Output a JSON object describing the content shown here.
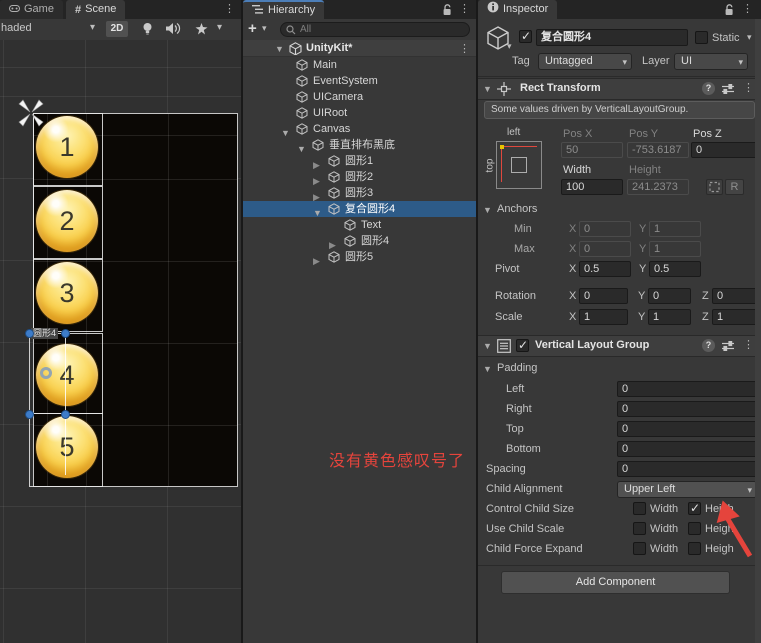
{
  "icons": {
    "ellipsis": "⋮",
    "caret": "▾",
    "tri_open": "▼",
    "tri_closed": "▶",
    "scene_tab": "#",
    "plus": "+",
    "help": "?"
  },
  "scene": {
    "tabs": [
      {
        "label": "Game"
      },
      {
        "label": "Scene"
      }
    ],
    "toolbar": {
      "shading": "haded",
      "mode2d": "2D"
    },
    "circles": [
      {
        "label": "1"
      },
      {
        "label": "2"
      },
      {
        "label": "3"
      },
      {
        "label": "4"
      },
      {
        "label": "5"
      }
    ],
    "selection_tag": "圆形4"
  },
  "hierarchy": {
    "tab": "Hierarchy",
    "search_placeholder": "All",
    "root_name": "UnityKit*",
    "items": [
      {
        "label": "Main",
        "depth": 1,
        "arrow": "none"
      },
      {
        "label": "EventSystem",
        "depth": 1,
        "arrow": "none"
      },
      {
        "label": "UICamera",
        "depth": 1,
        "arrow": "none"
      },
      {
        "label": "UIRoot",
        "depth": 1,
        "arrow": "none"
      },
      {
        "label": "Canvas",
        "depth": 1,
        "arrow": "open"
      },
      {
        "label": "垂直排布黑底",
        "depth": 2,
        "arrow": "open"
      },
      {
        "label": "圆形1",
        "depth": 3,
        "arrow": "closed"
      },
      {
        "label": "圆形2",
        "depth": 3,
        "arrow": "closed"
      },
      {
        "label": "圆形3",
        "depth": 3,
        "arrow": "closed"
      },
      {
        "label": "复合圆形4",
        "depth": 3,
        "arrow": "open",
        "selected": true
      },
      {
        "label": "Text",
        "depth": 4,
        "arrow": "none"
      },
      {
        "label": "圆形4",
        "depth": 4,
        "arrow": "closed"
      },
      {
        "label": "圆形5",
        "depth": 3,
        "arrow": "closed"
      }
    ],
    "annotation": "没有黄色感叹号了"
  },
  "inspector": {
    "tab": "Inspector",
    "header": {
      "name": "复合圆形4",
      "static_label": "Static",
      "tag_label": "Tag",
      "tag_value": "Untagged",
      "layer_label": "Layer",
      "layer_value": "UI"
    },
    "rect_transform": {
      "title": "Rect Transform",
      "info": "Some values driven by VerticalLayoutGroup.",
      "anchor_h": "left",
      "anchor_v": "top",
      "pos_x_label": "Pos X",
      "pos_y_label": "Pos Y",
      "pos_z_label": "Pos Z",
      "pos_x": "50",
      "pos_y": "-753.6187",
      "pos_z": "0",
      "width_label": "Width",
      "height_label": "Height",
      "width": "100",
      "height": "241.2373",
      "r_label": "R",
      "anchors_label": "Anchors",
      "min_label": "Min",
      "min_x": "0",
      "min_y": "1",
      "max_label": "Max",
      "max_x": "0",
      "max_y": "1",
      "pivot_label": "Pivot",
      "pivot_x": "0.5",
      "pivot_y": "0.5",
      "rotation_label": "Rotation",
      "rotation_x": "0",
      "rotation_y": "0",
      "rotation_z": "0",
      "scale_label": "Scale",
      "scale_x": "1",
      "scale_y": "1",
      "scale_z": "1",
      "x_label": "X",
      "y_label": "Y",
      "z_label": "Z"
    },
    "vlg": {
      "title": "Vertical Layout Group",
      "padding_label": "Padding",
      "padding": [
        {
          "label": "Left",
          "value": "0"
        },
        {
          "label": "Right",
          "value": "0"
        },
        {
          "label": "Top",
          "value": "0"
        },
        {
          "label": "Bottom",
          "value": "0"
        }
      ],
      "spacing_label": "Spacing",
      "spacing": "0",
      "child_alignment_label": "Child Alignment",
      "child_alignment_value": "Upper Left",
      "width_label": "Width",
      "height_label": "Heigh",
      "check_rows": [
        {
          "label": "Control Child Size",
          "width_checked": false,
          "height_checked": true
        },
        {
          "label": "Use Child Scale",
          "width_checked": false,
          "height_checked": false
        },
        {
          "label": "Child Force Expand",
          "width_checked": false,
          "height_checked": false
        }
      ]
    },
    "add_component": "Add Component"
  }
}
